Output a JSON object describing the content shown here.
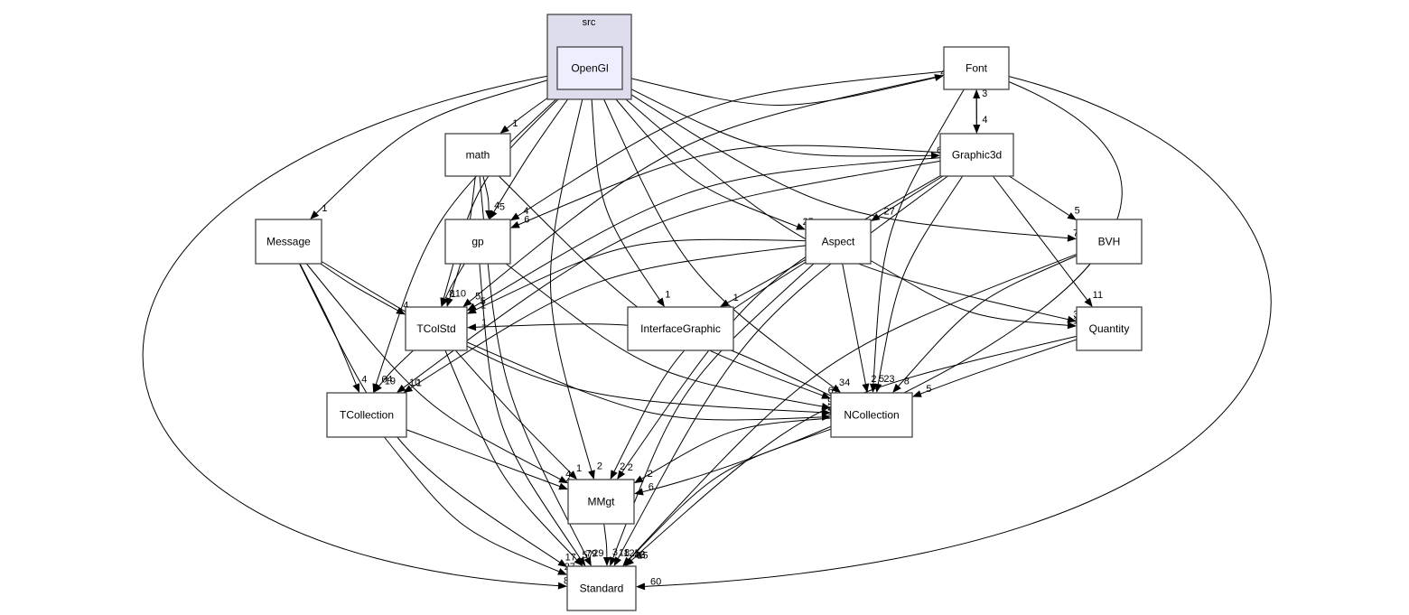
{
  "cluster": {
    "label": "src",
    "fill": "#ddddee"
  },
  "focus_fill": "#eeeeff",
  "nodes": [
    {
      "id": "OpenGl",
      "label": "OpenGl",
      "focus": true
    },
    {
      "id": "Font",
      "label": "Font"
    },
    {
      "id": "Graphic3d",
      "label": "Graphic3d"
    },
    {
      "id": "math",
      "label": "math"
    },
    {
      "id": "Message",
      "label": "Message"
    },
    {
      "id": "gp",
      "label": "gp"
    },
    {
      "id": "Aspect",
      "label": "Aspect"
    },
    {
      "id": "BVH",
      "label": "BVH"
    },
    {
      "id": "TColStd",
      "label": "TColStd"
    },
    {
      "id": "InterfaceGraphic",
      "label": "InterfaceGraphic"
    },
    {
      "id": "Quantity",
      "label": "Quantity"
    },
    {
      "id": "TCollection",
      "label": "TCollection"
    },
    {
      "id": "NCollection",
      "label": "NCollection"
    },
    {
      "id": "MMgt",
      "label": "MMgt"
    },
    {
      "id": "Standard",
      "label": "Standard"
    }
  ],
  "edges": [
    {
      "from": "OpenGl",
      "to": "Font",
      "label": "4"
    },
    {
      "from": "OpenGl",
      "to": "Graphic3d",
      "label": "61"
    },
    {
      "from": "OpenGl",
      "to": "math",
      "label": "1"
    },
    {
      "from": "OpenGl",
      "to": "gp",
      "label": "5"
    },
    {
      "from": "OpenGl",
      "to": "Message",
      "label": "1"
    },
    {
      "from": "OpenGl",
      "to": "Aspect",
      "label": "25"
    },
    {
      "from": "OpenGl",
      "to": "BVH",
      "label": "7"
    },
    {
      "from": "OpenGl",
      "to": "TColStd",
      "label": "8"
    },
    {
      "from": "OpenGl",
      "to": "InterfaceGraphic",
      "label": "1"
    },
    {
      "from": "OpenGl",
      "to": "Quantity",
      "label": "3"
    },
    {
      "from": "OpenGl",
      "to": "TCollection",
      "label": "64"
    },
    {
      "from": "OpenGl",
      "to": "NCollection",
      "label": "34"
    },
    {
      "from": "OpenGl",
      "to": "MMgt",
      "label": "2"
    },
    {
      "from": "OpenGl",
      "to": "Standard",
      "label": "87"
    },
    {
      "from": "Font",
      "to": "Graphic3d",
      "label": "4"
    },
    {
      "from": "Graphic3d",
      "to": "Font",
      "label": "3"
    },
    {
      "from": "Font",
      "to": "gp",
      "label": "4"
    },
    {
      "from": "Font",
      "to": "TColStd",
      "label": "5"
    },
    {
      "from": "Font",
      "to": "NCollection",
      "label": "5"
    },
    {
      "from": "Font",
      "to": "MMgt",
      "label": "6"
    },
    {
      "from": "Font",
      "to": "Standard",
      "label": "60"
    },
    {
      "from": "Graphic3d",
      "to": "gp",
      "label": "6"
    },
    {
      "from": "Graphic3d",
      "to": "Aspect",
      "label": "27"
    },
    {
      "from": "Graphic3d",
      "to": "BVH",
      "label": "5"
    },
    {
      "from": "Graphic3d",
      "to": "Quantity",
      "label": "11"
    },
    {
      "from": "Graphic3d",
      "to": "TColStd",
      "label": "5"
    },
    {
      "from": "Graphic3d",
      "to": "TCollection",
      "label": "10"
    },
    {
      "from": "Graphic3d",
      "to": "NCollection",
      "label": "23"
    },
    {
      "from": "Graphic3d",
      "to": "MMgt",
      "label": "2"
    },
    {
      "from": "Graphic3d",
      "to": "Standard",
      "label": "125"
    },
    {
      "from": "math",
      "to": "gp",
      "label": "4"
    },
    {
      "from": "math",
      "to": "TColStd",
      "label": "10"
    },
    {
      "from": "math",
      "to": "NCollection",
      "label": "67"
    },
    {
      "from": "math",
      "to": "Standard",
      "label": "29"
    },
    {
      "from": "Message",
      "to": "TColStd",
      "label": "4"
    },
    {
      "from": "Message",
      "to": "TCollection",
      "label": "4"
    },
    {
      "from": "Message",
      "to": "NCollection",
      "label": "2"
    },
    {
      "from": "Message",
      "to": "MMgt",
      "label": "4"
    },
    {
      "from": "Message",
      "to": "Standard",
      "label": "17"
    },
    {
      "from": "gp",
      "to": "TColStd",
      "label": "1"
    },
    {
      "from": "gp",
      "to": "NCollection",
      "label": "9"
    },
    {
      "from": "gp",
      "to": "Standard",
      "label": "79"
    },
    {
      "from": "Aspect",
      "to": "TColStd",
      "label": "1"
    },
    {
      "from": "Aspect",
      "to": "InterfaceGraphic",
      "label": "1"
    },
    {
      "from": "Aspect",
      "to": "Quantity",
      "label": "13"
    },
    {
      "from": "Aspect",
      "to": "TCollection",
      "label": "1"
    },
    {
      "from": "Aspect",
      "to": "NCollection",
      "label": "2"
    },
    {
      "from": "Aspect",
      "to": "MMgt",
      "label": "2"
    },
    {
      "from": "Aspect",
      "to": "Standard",
      "label": "18"
    },
    {
      "from": "BVH",
      "to": "NCollection",
      "label": "8"
    },
    {
      "from": "BVH",
      "to": "Standard",
      "label": "12"
    },
    {
      "from": "TColStd",
      "to": "TCollection",
      "label": "19"
    },
    {
      "from": "TColStd",
      "to": "NCollection",
      "label": "1"
    },
    {
      "from": "NCollection",
      "to": "TColStd",
      "label": "1"
    },
    {
      "from": "TColStd",
      "to": "MMgt",
      "label": "1"
    },
    {
      "from": "TColStd",
      "to": "Standard",
      "label": "57"
    },
    {
      "from": "Quantity",
      "to": "NCollection",
      "label": "5"
    },
    {
      "from": "Quantity",
      "to": "Standard",
      "label": "15"
    },
    {
      "from": "TCollection",
      "to": "MMgt",
      "label": "4"
    },
    {
      "from": "TCollection",
      "to": "Standard",
      "label": "27"
    },
    {
      "from": "NCollection",
      "to": "MMgt",
      "label": "2"
    },
    {
      "from": "NCollection",
      "to": "Standard",
      "label": "46"
    },
    {
      "from": "MMgt",
      "to": "Standard",
      "label": "3"
    }
  ]
}
